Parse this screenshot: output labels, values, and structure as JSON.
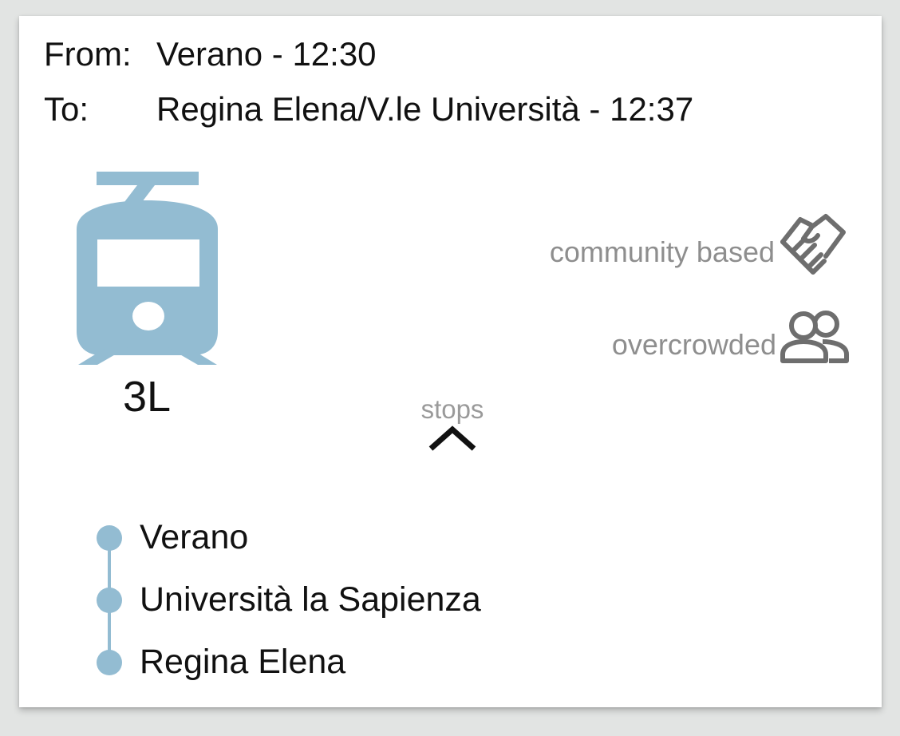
{
  "route": {
    "from_label": "From:",
    "from_value": "Verano - 12:30",
    "to_label": "To:",
    "to_value": "Regina Elena/V.le Università - 12:37"
  },
  "vehicle": {
    "icon": "tram-icon",
    "line": "3L",
    "color": "#93bcd2"
  },
  "tags": {
    "community": {
      "label": "community based",
      "icon": "handshake-icon"
    },
    "crowd": {
      "label": "overcrowded",
      "icon": "people-icon"
    }
  },
  "stops_toggle": {
    "label": "stops",
    "icon": "chevron-up-icon"
  },
  "stops": [
    {
      "name": "Verano"
    },
    {
      "name": "Università la Sapienza"
    },
    {
      "name": "Regina Elena"
    }
  ],
  "colors": {
    "accent": "#93bcd2",
    "tag_text": "#8e8e8e",
    "tag_icon": "#6e6e6e",
    "background": "#e2e4e3",
    "card": "#ffffff"
  }
}
